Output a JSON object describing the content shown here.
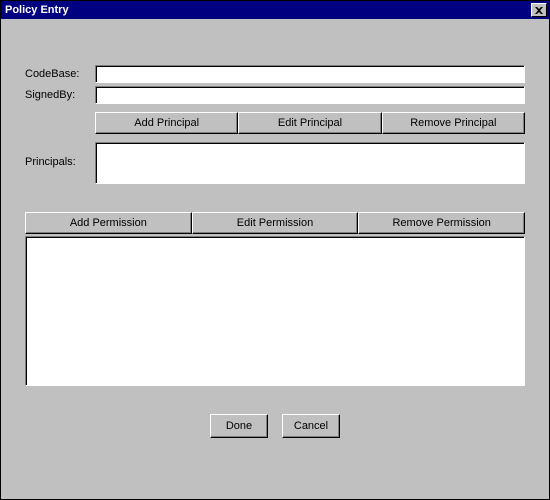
{
  "window": {
    "title": "Policy Entry"
  },
  "labels": {
    "codebase": "CodeBase:",
    "signedby": "SignedBy:",
    "principals": "Principals:"
  },
  "fields": {
    "codebase": "",
    "signedby": ""
  },
  "principalButtons": {
    "add": "Add Principal",
    "edit": "Edit Principal",
    "remove": "Remove Principal"
  },
  "permissionButtons": {
    "add": "Add Permission",
    "edit": "Edit Permission",
    "remove": "Remove Permission"
  },
  "actions": {
    "done": "Done",
    "cancel": "Cancel"
  }
}
